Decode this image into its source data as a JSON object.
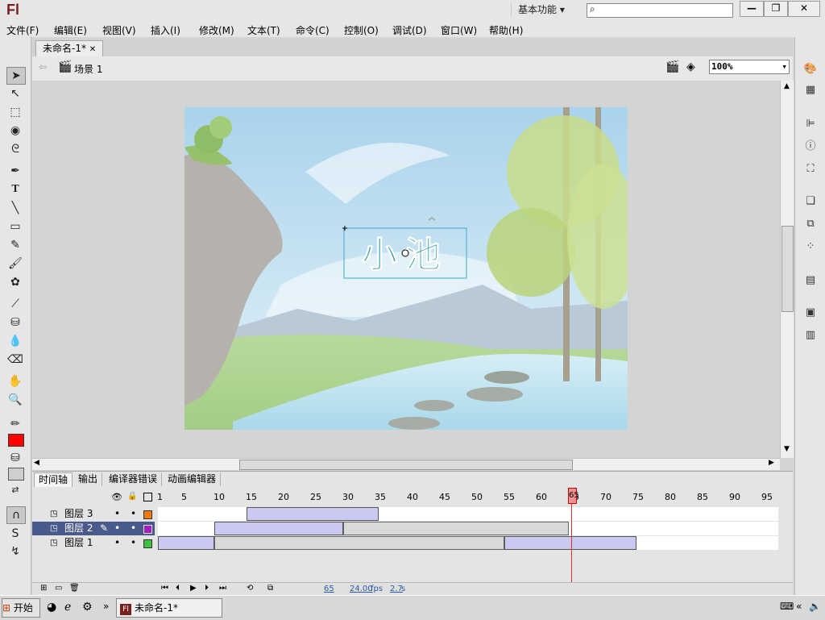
{
  "app": {
    "logo": "Fl",
    "workspace": "基本功能",
    "search_placeholder": ""
  },
  "menu": [
    "文件(F)",
    "编辑(E)",
    "视图(V)",
    "插入(I)",
    "修改(M)",
    "文本(T)",
    "命令(C)",
    "控制(O)",
    "调试(D)",
    "窗口(W)",
    "帮助(H)"
  ],
  "document": {
    "tab_label": "未命名-1*",
    "scene_label": "场景 1",
    "zoom": "100%",
    "stage_text": "小池"
  },
  "timeline": {
    "tabs": [
      "时间轴",
      "输出",
      "编译器错误",
      "动画编辑器"
    ],
    "layers": [
      {
        "name": "图层 3",
        "color": "#f07a10",
        "selected": false
      },
      {
        "name": "图层 2",
        "color": "#a020c0",
        "selected": true
      },
      {
        "name": "图层 1",
        "color": "#40c040",
        "selected": false
      }
    ],
    "frame_numbers": [
      "1",
      "5",
      "10",
      "15",
      "20",
      "25",
      "30",
      "35",
      "40",
      "45",
      "50",
      "55",
      "60",
      "65",
      "70",
      "75",
      "80",
      "85",
      "90",
      "95"
    ],
    "current_frame": "65",
    "fps": "24.00",
    "fps_unit": "fps",
    "time": "2.7",
    "time_unit": "s"
  },
  "taskbar": {
    "start_label": "开始",
    "task_label": "未命名-1*"
  },
  "colors": {
    "stroke": "#000000",
    "fill": "#ff0000"
  }
}
